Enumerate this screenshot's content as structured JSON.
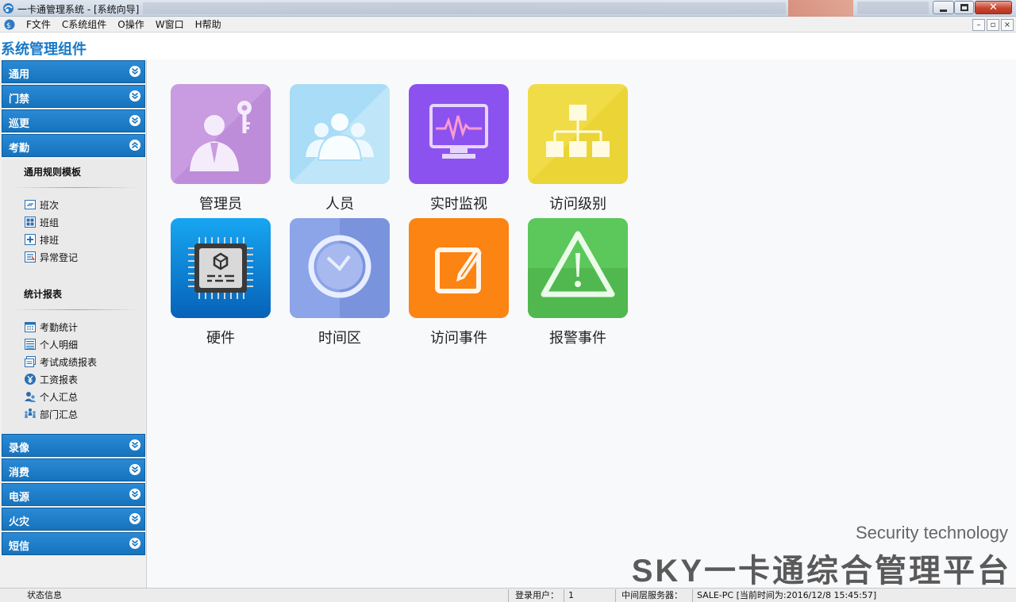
{
  "window": {
    "title": "一卡通管理系统 - [系统向导]",
    "close_glyph": "✕",
    "mdi_minimize": "–",
    "mdi_restore": "▫",
    "mdi_close": "×"
  },
  "menu": [
    "F文件",
    "C系统组件",
    "O操作",
    "W窗口",
    "H帮助"
  ],
  "component_title": "系统管理组件",
  "sidebar": {
    "groups_top": [
      {
        "label": "通用",
        "expanded": false
      },
      {
        "label": "门禁",
        "expanded": false
      },
      {
        "label": "巡更",
        "expanded": false
      },
      {
        "label": "考勤",
        "expanded": true
      }
    ],
    "groups_bottom": [
      {
        "label": "录像",
        "expanded": false
      },
      {
        "label": "消费",
        "expanded": false
      },
      {
        "label": "电源",
        "expanded": false
      },
      {
        "label": "火灾",
        "expanded": false
      },
      {
        "label": "短信",
        "expanded": false
      }
    ],
    "attendance": {
      "section1_title": "通用规则模板",
      "section1_items": [
        {
          "label": "班次",
          "icon": "shift-icon"
        },
        {
          "label": "班组",
          "icon": "group-grid-icon"
        },
        {
          "label": "排班",
          "icon": "schedule-plus-icon"
        },
        {
          "label": "异常登记",
          "icon": "exception-register-icon"
        }
      ],
      "section2_title": "统计报表",
      "section2_items": [
        {
          "label": "考勤统计",
          "icon": "calendar-icon"
        },
        {
          "label": "个人明细",
          "icon": "list-icon"
        },
        {
          "label": "考试成绩报表",
          "icon": "report-stack-icon"
        },
        {
          "label": "工资报表",
          "icon": "yen-icon"
        },
        {
          "label": "个人汇总",
          "icon": "person-group-icon"
        },
        {
          "label": "部门汇总",
          "icon": "department-icon"
        }
      ]
    }
  },
  "tiles": [
    {
      "label": "管理员",
      "icon": "admin-key-icon",
      "color": "#c99be0"
    },
    {
      "label": "人员",
      "icon": "people-icon",
      "color": "#a9dcf6"
    },
    {
      "label": "实时监视",
      "icon": "monitor-pulse-icon",
      "color": "#8b52ef"
    },
    {
      "label": "访问级别",
      "icon": "hierarchy-icon",
      "color": "#f0dc47"
    },
    {
      "label": "硬件",
      "icon": "chip-icon",
      "color": "#1187dc"
    },
    {
      "label": "时间区",
      "icon": "clock-icon",
      "color": "#8ca4e8"
    },
    {
      "label": "访问事件",
      "icon": "edit-note-icon",
      "color": "#fb8412"
    },
    {
      "label": "报警事件",
      "icon": "warning-icon",
      "color": "#5cc75b"
    }
  ],
  "branding": {
    "line1": "Security technology",
    "line2": "SKY一卡通综合管理平台"
  },
  "status": {
    "info_label": "状态信息",
    "user_label": "登录用户：",
    "user_value": "1",
    "server_label": "中间层服务器：",
    "server_value": "SALE-PC [当前时间为:2016/12/8 15:45:57]"
  }
}
